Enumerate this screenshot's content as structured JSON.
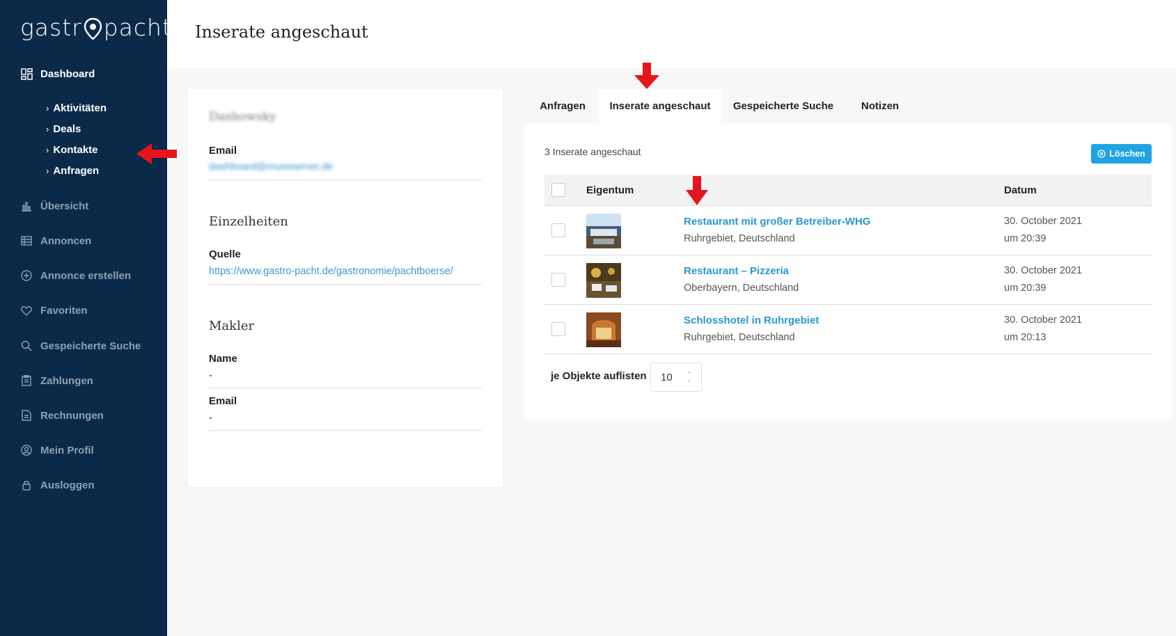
{
  "sidebar": {
    "logo_left": "gastr",
    "logo_right": "pacht",
    "dashboard": "Dashboard",
    "sub_items": [
      "Aktivitäten",
      "Deals",
      "Kontakte",
      "Anfragen"
    ],
    "items": [
      "Übersicht",
      "Annoncen",
      "Annonce erstellen",
      "Favoriten",
      "Gespeicherte Suche",
      "Zahlungen",
      "Rechnungen",
      "Mein Profil",
      "Ausloggen"
    ]
  },
  "header": {
    "title": "Inserate angeschaut"
  },
  "contact": {
    "name": "Dashowsky",
    "email_label": "Email",
    "email_value": "dashboard@musoserver.de",
    "details_title": "Einzelheiten",
    "source_label": "Quelle",
    "source_value": "https://www.gastro-pacht.de/gastronomie/pachtboerse/",
    "broker_title": "Makler",
    "broker_name_label": "Name",
    "broker_name_value": "-",
    "broker_email_label": "Email",
    "broker_email_value": "-"
  },
  "tabs": [
    "Anfragen",
    "Inserate angeschaut",
    "Gespeicherte Suche",
    "Notizen"
  ],
  "viewed": {
    "count_text": "3 Inserate angeschaut",
    "delete_label": "Löschen",
    "col_property": "Eigentum",
    "col_date": "Datum",
    "rows": [
      {
        "title": "Restaurant mit großer Betreiber-WHG",
        "location": "Ruhrgebiet, Deutschland",
        "date": "30. October 2021",
        "time": "um 20:39"
      },
      {
        "title": "Restaurant – Pizzeria",
        "location": "Oberbayern, Deutschland",
        "date": "30. October 2021",
        "time": "um 20:39"
      },
      {
        "title": "Schlosshotel in Ruhrgebiet",
        "location": "Ruhrgebiet, Deutschland",
        "date": "30. October 2021",
        "time": "um 20:13"
      }
    ],
    "per_page_label": "je Objekte auflisten",
    "per_page_value": "10"
  },
  "colors": {
    "sidebar_bg": "#0b2a4a",
    "accent": "#1ea4e3",
    "link": "#2b97d1",
    "annotation_arrow": "#e8141b"
  }
}
